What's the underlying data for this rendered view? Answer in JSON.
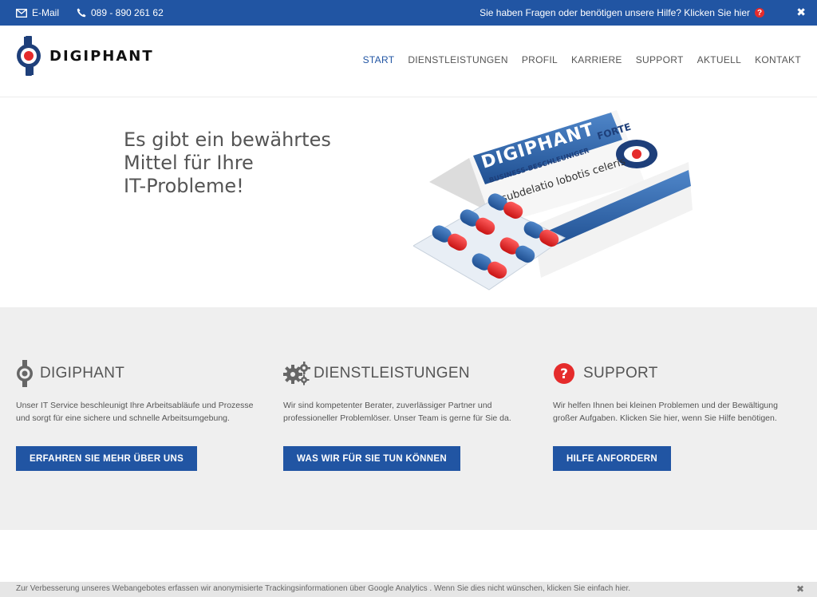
{
  "topbar": {
    "email_label": "E-Mail",
    "phone": "089 - 890 261 62",
    "help_text": "Sie haben Fragen oder benötigen unsere Hilfe? Klicken Sie hier",
    "close": "✖"
  },
  "header": {
    "logo_text": "DIGIPHANT",
    "nav": [
      "START",
      "DIENSTLEISTUNGEN",
      "PROFIL",
      "KARRIERE",
      "SUPPORT",
      "AKTUELL",
      "KONTAKT"
    ]
  },
  "hero": {
    "line1": "Es gibt ein bewährtes",
    "line2": "Mittel für Ihre",
    "line3": "IT-Probleme!",
    "box_brand": "DIGIPHANT",
    "box_forte": "FORTE",
    "box_sub": "BUSINESS-BESCHLEUNIGER",
    "box_latin": "subdelatio lobotis celeris"
  },
  "features": [
    {
      "title": "DIGIPHANT",
      "text": "Unser IT Service beschleunigt Ihre Arbeitsabläufe und Prozesse und sorgt für eine sichere und schnelle Arbeitsumgebung.",
      "button": "ERFAHREN SIE MEHR ÜBER UNS",
      "icon": "digiphant-logo-icon"
    },
    {
      "title": "DIENSTLEISTUNGEN",
      "text": "Wir sind kompetenter Berater, zuverlässiger Partner und professioneller Problemlöser. Unser Team is gerne für Sie da.",
      "button": "WAS WIR FÜR SIE TUN KÖNNEN",
      "icon": "gears-icon"
    },
    {
      "title": "SUPPORT",
      "text": "Wir helfen Ihnen bei kleinen Problemen und der Bewältigung großer Aufgaben. Klicken Sie hier, wenn Sie Hilfe benötigen.",
      "button": "HILFE ANFORDERN",
      "icon": "question-circle-icon"
    }
  ],
  "cookie": {
    "text": "Zur Verbesserung unseres Webangebotes erfassen wir anonymisierte Trackingsinformationen über Google Analytics . Wenn Sie dies nicht wünschen, klicken Sie einfach hier.",
    "close": "✖"
  },
  "colors": {
    "brand_blue": "#2155a3",
    "accent_red": "#e52b2b",
    "feature_bg": "#efefef"
  }
}
